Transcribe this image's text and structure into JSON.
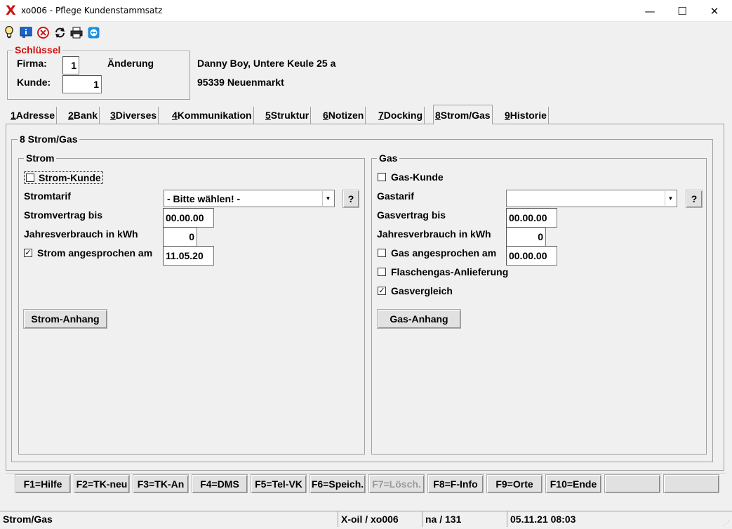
{
  "window": {
    "logo": "X",
    "title": "xo006 - Pflege Kundenstammsatz",
    "minimize": "—",
    "maximize": "☐",
    "close": "✕"
  },
  "toolbar": {
    "icons": [
      "lightbulb-icon",
      "info-icon",
      "cancel-icon",
      "refresh-icon",
      "print-icon",
      "teamviewer-icon"
    ]
  },
  "key_section": {
    "legend": "Schlüssel",
    "firma_label": "Firma:",
    "firma_value": "1",
    "kunde_label": "Kunde:",
    "kunde_value": "1",
    "mode": "Änderung",
    "address_line1": "Danny Boy, Untere Keule 25 a",
    "address_line2": "95339 Neuenmarkt"
  },
  "tabs": [
    {
      "num": "1",
      "label": " Adresse"
    },
    {
      "num": "2",
      "label": " Bank"
    },
    {
      "num": "3",
      "label": " Diverses"
    },
    {
      "num": "4",
      "label": " Kommunikation"
    },
    {
      "num": "5",
      "label": " Struktur"
    },
    {
      "num": "6",
      "label": " Notizen"
    },
    {
      "num": "7",
      "label": " Docking"
    },
    {
      "num": "8",
      "label": " Strom/Gas"
    },
    {
      "num": "9",
      "label": " Historie"
    }
  ],
  "panel": {
    "title": "8 Strom/Gas",
    "strom": {
      "legend": "Strom",
      "kunde_label": "Strom-Kunde",
      "kunde_checked": false,
      "tarif_label": "Stromtarif",
      "tarif_value": "- Bitte wählen! -",
      "help_label": "?",
      "vertrag_label": "Stromvertrag bis",
      "vertrag_value": "00.00.00",
      "verbrauch_label": "Jahresverbrauch in kWh",
      "verbrauch_value": "0",
      "angesprochen_label": "Strom angesprochen am",
      "angesprochen_checked": true,
      "angesprochen_value": "11.05.20",
      "anhang_label": "Strom-Anhang"
    },
    "gas": {
      "legend": "Gas",
      "kunde_label": "Gas-Kunde",
      "kunde_checked": false,
      "tarif_label": "Gastarif",
      "tarif_value": "",
      "help_label": "?",
      "vertrag_label": "Gasvertrag bis",
      "vertrag_value": "00.00.00",
      "verbrauch_label": "Jahresverbrauch in kWh",
      "verbrauch_value": "0",
      "angesprochen_label": "Gas angesprochen am",
      "angesprochen_checked": false,
      "angesprochen_value": "00.00.00",
      "flaschengas_label": "Flaschengas-Anlieferung",
      "flaschengas_checked": false,
      "vergleich_label": "Gasvergleich",
      "vergleich_checked": true,
      "anhang_label": "Gas-Anhang"
    }
  },
  "fkeys": [
    {
      "label": "F1=Hilfe",
      "enabled": true
    },
    {
      "label": "F2=TK-neu",
      "enabled": true
    },
    {
      "label": "F3=TK-An",
      "enabled": true
    },
    {
      "label": "F4=DMS",
      "enabled": true
    },
    {
      "label": "F5=Tel-VK",
      "enabled": true
    },
    {
      "label": "F6=Speich.",
      "enabled": true
    },
    {
      "label": "F7=Lösch.",
      "enabled": false
    },
    {
      "label": "F8=F-Info",
      "enabled": true
    },
    {
      "label": "F9=Orte",
      "enabled": true
    },
    {
      "label": "F10=Ende",
      "enabled": true
    },
    {
      "label": "",
      "enabled": true
    },
    {
      "label": "",
      "enabled": true
    }
  ],
  "statusbar": {
    "section": "Strom/Gas",
    "app": "X-oil / xo006",
    "user": "na / 131",
    "datetime": "05.11.21 08:03"
  },
  "colors": {
    "accent_red": "#d01010",
    "background": "#f0f0f0"
  }
}
